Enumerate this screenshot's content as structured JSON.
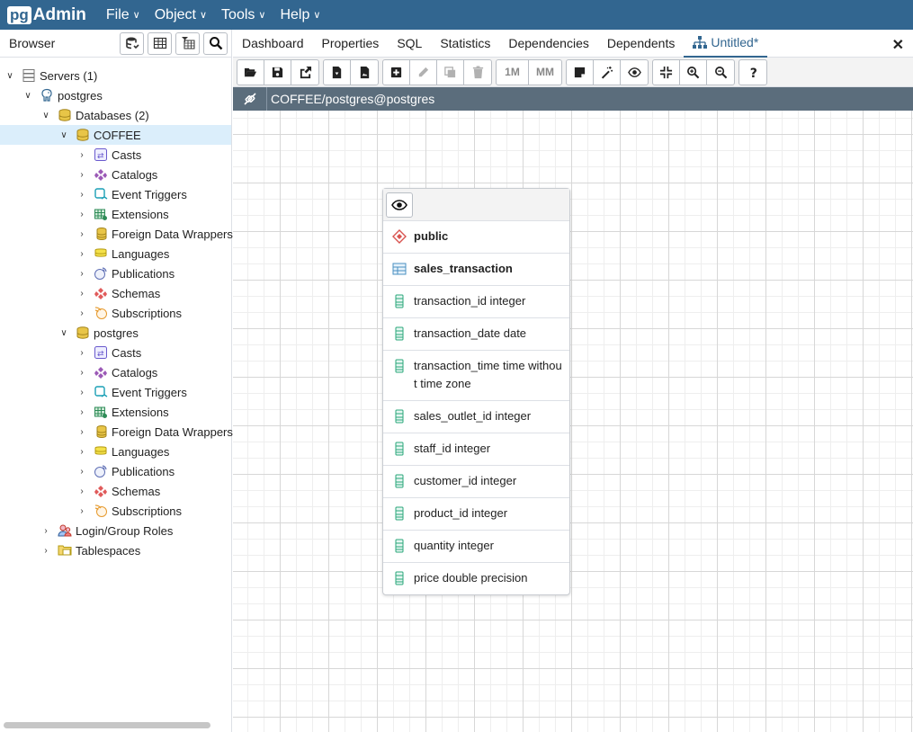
{
  "app": {
    "logo_pg": "pg",
    "logo_admin": "Admin"
  },
  "menu": [
    {
      "label": "File"
    },
    {
      "label": "Object"
    },
    {
      "label": "Tools"
    },
    {
      "label": "Help"
    }
  ],
  "browser": {
    "title": "Browser"
  },
  "tree": {
    "servers": "Servers (1)",
    "postgres_server": "postgres",
    "databases": "Databases (2)",
    "db1": {
      "name": "COFFEE",
      "children": [
        "Casts",
        "Catalogs",
        "Event Triggers",
        "Extensions",
        "Foreign Data Wrappers",
        "Languages",
        "Publications",
        "Schemas",
        "Subscriptions"
      ]
    },
    "db2": {
      "name": "postgres",
      "children": [
        "Casts",
        "Catalogs",
        "Event Triggers",
        "Extensions",
        "Foreign Data Wrappers",
        "Languages",
        "Publications",
        "Schemas",
        "Subscriptions"
      ]
    },
    "login_roles": "Login/Group Roles",
    "tablespaces": "Tablespaces"
  },
  "tabs": [
    {
      "label": "Dashboard"
    },
    {
      "label": "Properties"
    },
    {
      "label": "SQL"
    },
    {
      "label": "Statistics"
    },
    {
      "label": "Dependencies"
    },
    {
      "label": "Dependents"
    },
    {
      "label": "Untitled*"
    }
  ],
  "toolbar": {
    "one_to_many": "1M",
    "many_to_many": "MM"
  },
  "connection": {
    "label": "COFFEE/postgres@postgres"
  },
  "erd": {
    "schema": "public",
    "table": "sales_transaction",
    "columns": [
      {
        "text": "transaction_id integer"
      },
      {
        "text": "transaction_date date"
      },
      {
        "text": "transaction_time time without time zone"
      },
      {
        "text": "sales_outlet_id integer"
      },
      {
        "text": "staff_id integer"
      },
      {
        "text": "customer_id integer"
      },
      {
        "text": "product_id integer"
      },
      {
        "text": "quantity integer"
      },
      {
        "text": "price double precision"
      }
    ]
  },
  "colors": {
    "navbar": "#326690",
    "selected": "#dbeefb",
    "connbar": "#5b6d7c"
  }
}
